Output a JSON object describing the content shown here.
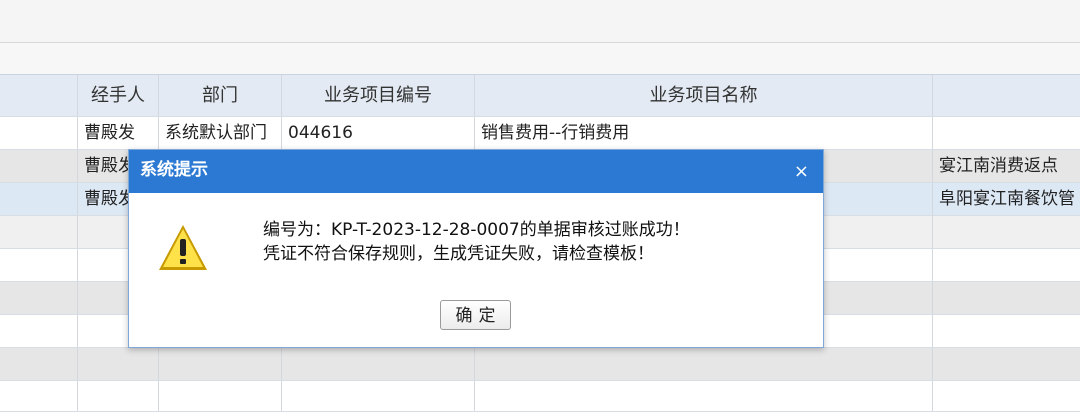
{
  "table": {
    "headers": [
      "",
      "经手人",
      "部门",
      "业务项目编号",
      "业务项目名称",
      ""
    ],
    "rows": [
      [
        "",
        "曹殿发",
        "系统默认部门",
        "044616",
        "销售费用--行销费用",
        ""
      ],
      [
        "",
        "曹殿发",
        "",
        "",
        "",
        "宴江南消费返点"
      ],
      [
        "",
        "曹殿发",
        "",
        "",
        "",
        "阜阳宴江南餐饮管"
      ]
    ]
  },
  "dialog": {
    "title": "系统提示",
    "close": "×",
    "line1": "编号为：KP-T-2023-12-28-0007的单据审核过账成功！",
    "line2": "凭证不符合保存规则，生成凭证失败，请检查模板！",
    "ok_label": "确定",
    "icon": "warning-icon",
    "accent_color": "#2b79d3"
  }
}
